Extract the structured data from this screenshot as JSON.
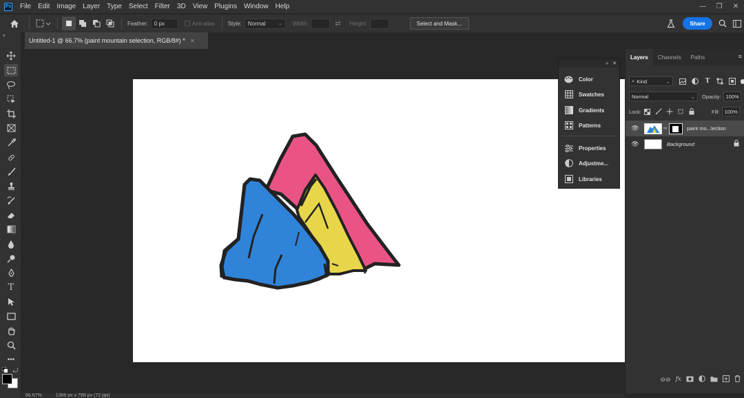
{
  "app": {
    "logo": "Ps"
  },
  "menu": [
    "File",
    "Edit",
    "Image",
    "Layer",
    "Type",
    "Select",
    "Filter",
    "3D",
    "View",
    "Plugins",
    "Window",
    "Help"
  ],
  "options": {
    "feather_label": "Feather:",
    "feather_value": "0 px",
    "antialias_label": "Anti-alias",
    "style_label": "Style:",
    "style_value": "Normal",
    "width_label": "Width:",
    "height_label": "Height:",
    "select_mask_label": "Select and Mask...",
    "share_label": "Share"
  },
  "document": {
    "tab_title": "Untitled-1 @ 66.7% (paint mountain selection, RGB/8#) *",
    "close": "×"
  },
  "dock": {
    "items": [
      "Color",
      "Swatches",
      "Gradients",
      "Patterns",
      "Properties",
      "Adjustme...",
      "Libraries"
    ]
  },
  "layers_panel": {
    "tabs": [
      "Layers",
      "Channels",
      "Paths"
    ],
    "filter_value": "Kind",
    "blend_mode": "Normal",
    "opacity_label": "Opacity:",
    "opacity_value": "100%",
    "lock_label": "Lock:",
    "fill_label": "Fill:",
    "fill_value": "100%",
    "layers": [
      {
        "name": "paint mo...lection",
        "selected": true
      },
      {
        "name": "Background",
        "selected": false
      }
    ]
  },
  "status": {
    "zoom": "66.67%",
    "doc_size": "1366 px x 768 px (72 ppi)"
  },
  "colors": {
    "accent": "#1473e6",
    "mountain_pink": "#ea5484",
    "mountain_blue": "#2f84d9",
    "mountain_yellow": "#e8d64a",
    "outline": "#222222"
  }
}
